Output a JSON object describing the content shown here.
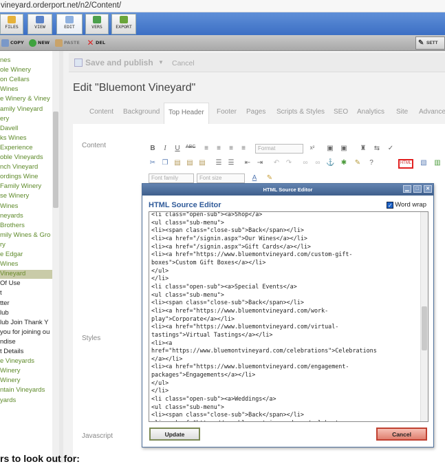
{
  "browser": {
    "url": "vineyard.orderport.net/n2/Content/"
  },
  "ribbon": [
    {
      "label": "FILES",
      "color": "#e6b23a",
      "icon": "folder-icon"
    },
    {
      "label": "VIEW",
      "color": "#5a82c8",
      "icon": "eye-icon"
    },
    {
      "label": "EDIT",
      "color": "#8fb1e0",
      "icon": "edit-icon"
    },
    {
      "label": "VERS",
      "color": "#4ca04c",
      "icon": "versions-icon"
    },
    {
      "label": "EXPORT",
      "color": "#6aa53a",
      "icon": "export-icon"
    }
  ],
  "toolbar": {
    "copy": "COPY",
    "new": "NEW",
    "paste": "PASTE",
    "del": "DEL",
    "settings": "SETT"
  },
  "sidebar": [
    {
      "label": "nes",
      "style": "green"
    },
    {
      "label": "ole Winery",
      "style": "green"
    },
    {
      "label": "on Cellars",
      "style": "green"
    },
    {
      "label": "Wines",
      "style": "green"
    },
    {
      "label": "e Winery & Viney",
      "style": "green"
    },
    {
      "label": "amily Vineyard",
      "style": "green"
    },
    {
      "label": "ery",
      "style": "green"
    },
    {
      "label": "Davell",
      "style": "green"
    },
    {
      "label": "ks Wines",
      "style": "green"
    },
    {
      "label": "Experience",
      "style": "green"
    },
    {
      "label": "oble Vineyards",
      "style": "green"
    },
    {
      "label": "nch Vineyard",
      "style": "green"
    },
    {
      "label": "ordings Wine",
      "style": "green"
    },
    {
      "label": "Family Winery",
      "style": "green"
    },
    {
      "label": "se Winery",
      "style": "green"
    },
    {
      "label": "Wines",
      "style": "green"
    },
    {
      "label": "neyards",
      "style": "green"
    },
    {
      "label": "Brothers",
      "style": "green"
    },
    {
      "label": "mily Wines & Gro",
      "style": "green"
    },
    {
      "label": "ry",
      "style": "green"
    },
    {
      "label": "e Edgar",
      "style": "green"
    },
    {
      "label": "Wines",
      "style": "green"
    },
    {
      "label": "Vineyard",
      "style": "selected"
    },
    {
      "label": "Of Use",
      "style": "dark"
    },
    {
      "label": "t",
      "style": "dark"
    },
    {
      "label": "tter",
      "style": "dark"
    },
    {
      "label": "lub",
      "style": "dark"
    },
    {
      "label": "lub Join Thank Y",
      "style": "dark"
    },
    {
      "label": "you for joining ou",
      "style": "dark"
    },
    {
      "label": "ndise",
      "style": "dark"
    },
    {
      "label": "t Details",
      "style": "dark"
    },
    {
      "label": "e Vineyards",
      "style": "green"
    },
    {
      "label": "Winery",
      "style": "green"
    },
    {
      "label": "Winery",
      "style": "green"
    },
    {
      "label": "ntain Vineyards",
      "style": "green"
    },
    {
      "label": "yards",
      "style": "green"
    }
  ],
  "main": {
    "save_publish": "Save and publish",
    "cancel": "Cancel",
    "title": "Edit \"Bluemont Vineyard\"",
    "tabs": [
      "Content",
      "Background",
      "Top Header",
      "Footer",
      "Pages",
      "Scripts & Styles",
      "SEO",
      "Analytics",
      "Site",
      "Advanced"
    ],
    "active_tab": "Top Header",
    "labels": {
      "content": "Content",
      "styles": "Styles",
      "javascript": "Javascript"
    },
    "editor": {
      "format": "Format",
      "font_family": "Font family",
      "font_size": "Font size",
      "html_button": "HTML"
    }
  },
  "dialog": {
    "title": "HTML Source Editor",
    "heading": "HTML Source Editor",
    "word_wrap": "Word wrap",
    "word_wrap_checked": true,
    "update": "Update",
    "cancel": "Cancel",
    "code_lines": [
      "<li class=\"open-sub\"><a>Shop</a>",
      "<ul class=\"sub-menu\">",
      "<li><span class=\"close-sub\">Back</span></li>",
      "<li><a href=\"/signin.aspx\">Our Wines</a></li>",
      "<li><a href=\"/signin.aspx\">Gift Cards</a></li>",
      "<li><a href=\"https://www.bluemontvineyard.com/custom-gift-",
      "boxes\">Custom Gift Boxes</a></li>",
      "</ul>",
      "</li>",
      "<li class=\"open-sub\"><a>Special Events</a>",
      "<ul class=\"sub-menu\">",
      "<li><span class=\"close-sub\">Back</span></li>",
      "<li><a href=\"https://www.bluemontvineyard.com/work-",
      "play\">Corporate</a></li>",
      "<li><a href=\"https://www.bluemontvineyard.com/virtual-",
      "tastings\">Virtual Tastings</a></li>",
      "<li><a",
      "href=\"https://www.bluemontvineyard.com/celebrations\">Celebrations",
      "</a></li>",
      "<li><a href=\"https://www.bluemontvineyard.com/engagement-",
      "packages\">Engagements</a></li>",
      "</ul>",
      "</li>",
      "<li class=\"open-sub\"><a>Weddings</a>",
      "<ul class=\"sub-menu\">",
      "<li><span class=\"close-sub\">Back</span></li>",
      "<li><a href=\"https://www.bluemontvineyard.com/celebrate-your-"
    ]
  },
  "footer_text": "rs to look out for:"
}
